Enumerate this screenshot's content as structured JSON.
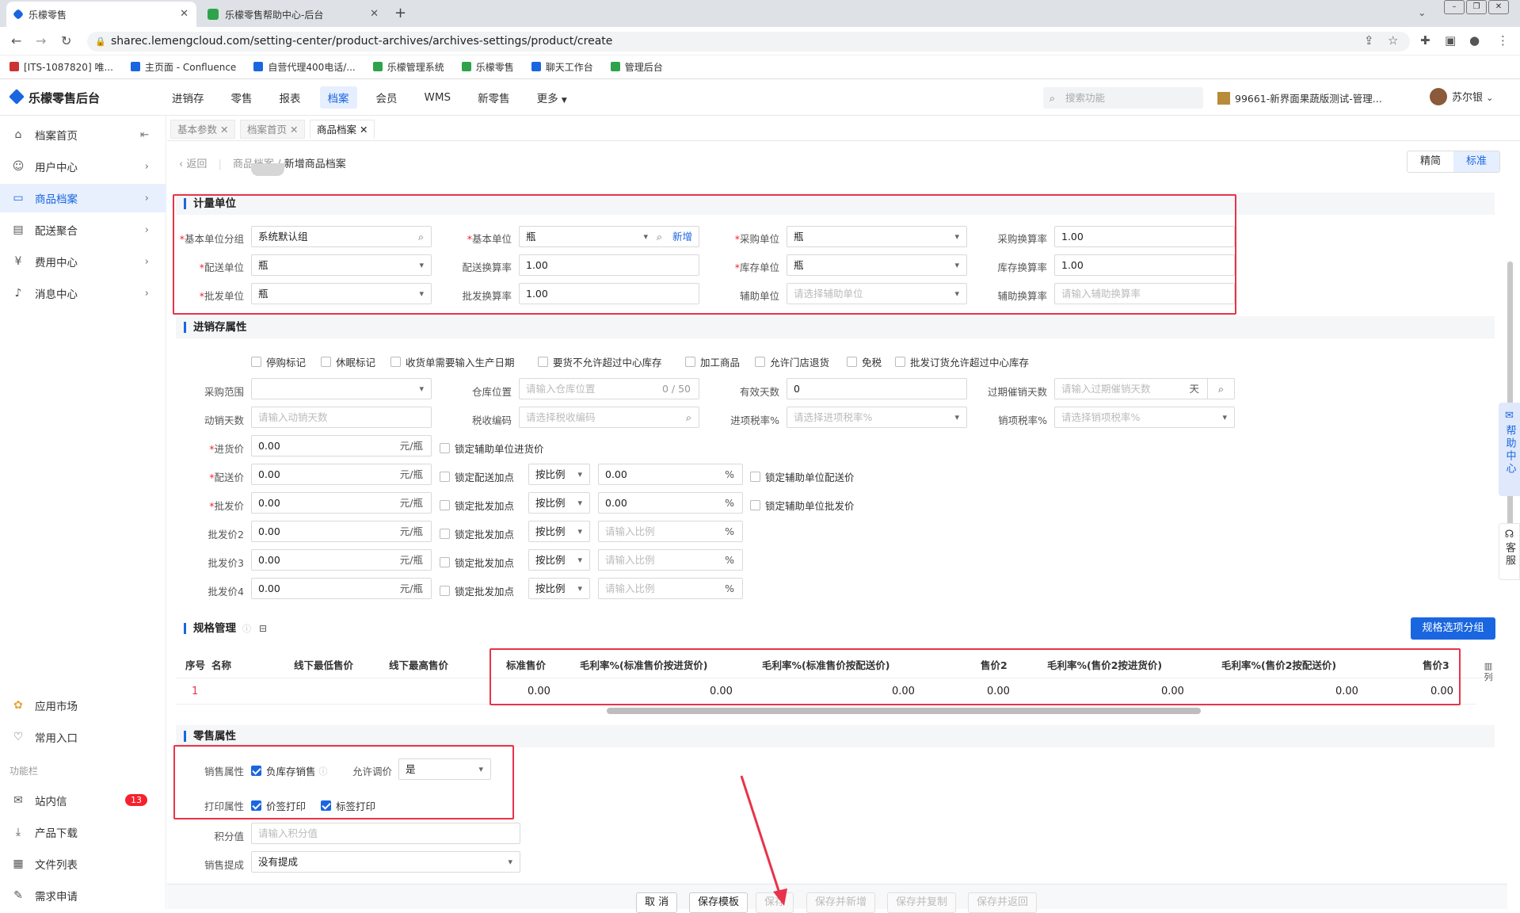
{
  "browser": {
    "tabs": [
      {
        "title": "乐檬零售"
      },
      {
        "title": "乐檬零售帮助中心-后台"
      }
    ],
    "url": "sharec.lemengcloud.com/setting-center/product-archives/archives-settings/product/create",
    "bookmarks": [
      "[ITS-1087820] 唯...",
      "主页面 - Confluence",
      "自营代理400电话/...",
      "乐檬管理系统",
      "乐檬零售",
      "聊天工作台",
      "管理后台"
    ]
  },
  "app": {
    "logo": "乐檬零售后台",
    "nav": [
      "进销存",
      "零售",
      "报表",
      "档案",
      "会员",
      "WMS",
      "新零售",
      "更多"
    ],
    "search_placeholder": "搜索功能",
    "store": "99661-新界面果蔬版测试-管理...",
    "user": "苏尔银"
  },
  "sidebar": {
    "items": [
      "档案首页",
      "用户中心",
      "商品档案",
      "配送聚合",
      "费用中心",
      "消息中心"
    ],
    "bottom": [
      "应用市场",
      "常用入口"
    ],
    "group_label": "功能栏",
    "tools": [
      "站内信",
      "产品下载",
      "文件列表",
      "需求申请"
    ],
    "unread": "13"
  },
  "content_tabs": [
    "基本参数",
    "档案首页",
    "商品档案"
  ],
  "breadcrumb": {
    "back": "返回",
    "parent": "商品档案",
    "current": "新增商品档案"
  },
  "mode": {
    "simple": "精简",
    "standard": "标准"
  },
  "unit": {
    "title": "计量单位",
    "fields": [
      {
        "label": "基本单位分组",
        "value": "系统默认组"
      },
      {
        "label": "基本单位",
        "value": "瓶",
        "add": "新增"
      },
      {
        "label": "采购单位",
        "value": "瓶"
      },
      {
        "label": "采购换算率",
        "value": "1.00"
      },
      {
        "label": "配送单位",
        "value": "瓶"
      },
      {
        "label": "配送换算率",
        "value": "1.00"
      },
      {
        "label": "库存单位",
        "value": "瓶"
      },
      {
        "label": "库存换算率",
        "value": "1.00"
      },
      {
        "label": "批发单位",
        "value": "瓶"
      },
      {
        "label": "批发换算率",
        "value": "1.00"
      },
      {
        "label": "辅助单位",
        "placeholder": "请选择辅助单位"
      },
      {
        "label": "辅助换算率",
        "placeholder": "请输入辅助换算率"
      }
    ]
  },
  "inventory": {
    "title": "进销存属性",
    "flags": [
      "停购标记",
      "休眠标记",
      "收货单需要输入生产日期",
      "要货不允许超过中心库存",
      "加工商品",
      "允许门店退货",
      "免税",
      "批发订货允许超过中心库存"
    ],
    "purchase_range": {
      "label": "采购范围",
      "value": ""
    },
    "warehouse": {
      "label": "仓库位置",
      "placeholder": "请输入仓库位置",
      "counter": "0 / 50"
    },
    "valid_days": {
      "label": "有效天数",
      "value": "0"
    },
    "expire_days": {
      "label": "过期催销天数",
      "placeholder": "请输入过期催销天数",
      "unit": "天"
    },
    "slow_days": {
      "label": "动销天数",
      "placeholder": "请输入动销天数"
    },
    "tax_code": {
      "label": "税收编码",
      "placeholder": "请选择税收编码"
    },
    "in_tax": {
      "label": "进项税率%",
      "placeholder": "请选择进项税率%"
    },
    "out_tax": {
      "label": "销项税率%",
      "placeholder": "请选择销项税率%"
    },
    "unit_suffix": "元/瓶",
    "prices": [
      {
        "label": "进货价",
        "value": "0.00",
        "lock": "锁定辅助单位进货价"
      },
      {
        "label": "配送价",
        "value": "0.00",
        "lock": "锁定配送加点",
        "mode": "按比例",
        "pct": "0.00",
        "lock2": "锁定辅助单位配送价"
      },
      {
        "label": "批发价",
        "value": "0.00",
        "lock": "锁定批发加点",
        "mode": "按比例",
        "pct": "0.00",
        "lock2": "锁定辅助单位批发价"
      },
      {
        "label": "批发价2",
        "value": "0.00",
        "lock": "锁定批发加点",
        "mode": "按比例",
        "pct_placeholder": "请输入比例"
      },
      {
        "label": "批发价3",
        "value": "0.00",
        "lock": "锁定批发加点",
        "mode": "按比例",
        "pct_placeholder": "请输入比例"
      },
      {
        "label": "批发价4",
        "value": "0.00",
        "lock": "锁定批发加点",
        "mode": "按比例",
        "pct_placeholder": "请输入比例"
      }
    ]
  },
  "spec": {
    "title": "规格管理",
    "group_button": "规格选项分组",
    "columns": [
      "序号",
      "名称",
      "线下最低售价",
      "线下最高售价",
      "标准售价",
      "毛利率%(标准售价按进货价)",
      "毛利率%(标准售价按配送价)",
      "售价2",
      "毛利率%(售价2按进货价)",
      "毛利率%(售价2按配送价)",
      "售价3"
    ],
    "col_setting": "列",
    "rows": [
      {
        "no": "1",
        "std": "0.00",
        "m1": "0.00",
        "m2": "0.00",
        "p2": "0.00",
        "m3": "0.00",
        "m4": "0.00",
        "p3": "0.00"
      }
    ]
  },
  "retail": {
    "title": "零售属性",
    "sale_label": "销售属性",
    "neg_stock": "负库存销售",
    "allow_adjust_label": "允许调价",
    "allow_adjust": "是",
    "print_label": "打印属性",
    "price_tag": "价签打印",
    "label_print": "标签打印",
    "points_label": "积分值",
    "points_placeholder": "请输入积分值",
    "commission_label": "销售提成",
    "commission": "没有提成"
  },
  "footer": {
    "buttons": [
      "取 消",
      "保存模板",
      "保存",
      "保存并新增",
      "保存并复制",
      "保存并返回"
    ]
  },
  "float": {
    "help": "帮助中心",
    "service": "客服"
  }
}
